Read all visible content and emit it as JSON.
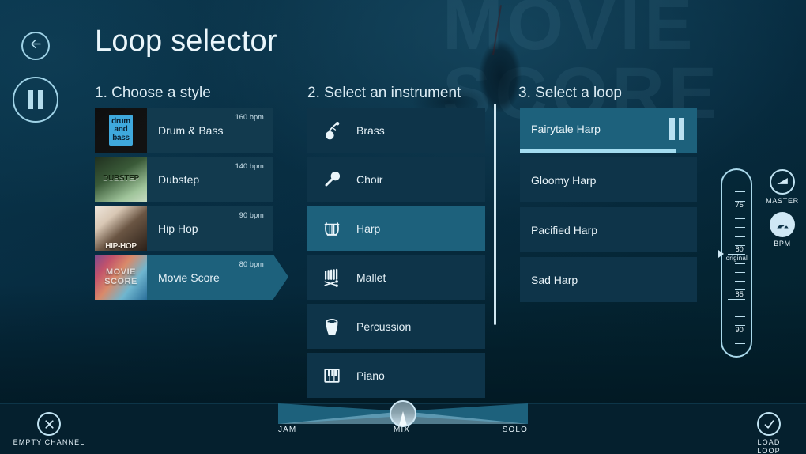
{
  "app": {
    "title": "Loop selector",
    "background_watermark": "MOVIE\nSCORE"
  },
  "header": {
    "back_icon": "back-arrow-icon",
    "transport_icon": "pause-icon"
  },
  "columns": {
    "style_heading": "1. Choose a style",
    "instrument_heading": "2. Select an instrument",
    "loop_heading": "3. Select a loop"
  },
  "styles": [
    {
      "name": "Drum & Bass",
      "bpm": "160 bpm",
      "thumb_text": "drum\nand\nbass",
      "selected": false
    },
    {
      "name": "Dubstep",
      "bpm": "140 bpm",
      "thumb_text": "DUBSTEP",
      "selected": false
    },
    {
      "name": "Hip Hop",
      "bpm": "90 bpm",
      "thumb_text": "HIP-HOP",
      "selected": false
    },
    {
      "name": "Movie Score",
      "bpm": "80 bpm",
      "thumb_text": "MOVIE\nSCORE",
      "selected": true
    }
  ],
  "instruments": [
    {
      "name": "Brass",
      "icon": "brass-horn-icon",
      "selected": false
    },
    {
      "name": "Choir",
      "icon": "microphone-icon",
      "selected": false
    },
    {
      "name": "Harp",
      "icon": "harp-lyre-icon",
      "selected": true
    },
    {
      "name": "Mallet",
      "icon": "xylophone-icon",
      "selected": false
    },
    {
      "name": "Percussion",
      "icon": "conga-drum-icon",
      "selected": false
    },
    {
      "name": "Piano",
      "icon": "piano-keys-icon",
      "selected": false
    }
  ],
  "loops": [
    {
      "name": "Fairytale Harp",
      "selected": true,
      "playing": true,
      "progress_percent": 88
    },
    {
      "name": "Gloomy Harp",
      "selected": false,
      "playing": false,
      "progress_percent": 0
    },
    {
      "name": "Pacified Harp",
      "selected": false,
      "playing": false,
      "progress_percent": 0
    },
    {
      "name": "Sad Harp",
      "selected": false,
      "playing": false,
      "progress_percent": 0
    }
  ],
  "bpm_slider": {
    "labels": [
      {
        "text": "75",
        "sub": ""
      },
      {
        "text": "80",
        "sub": "original"
      },
      {
        "text": "85",
        "sub": ""
      },
      {
        "text": "90",
        "sub": ""
      }
    ],
    "current_value": "80",
    "current_sub": "original"
  },
  "knobs": [
    {
      "label": "MASTER",
      "icon": "volume-wedge-icon",
      "style": "outline"
    },
    {
      "label": "BPM",
      "icon": "gauge-dial-icon",
      "style": "filled"
    }
  ],
  "bottom_bar": {
    "empty_channel_label": "EMPTY CHANNEL",
    "empty_channel_icon": "close-x-circle-icon",
    "load_loop_label": "LOAD\nLOOP",
    "load_loop_icon": "check-circle-icon",
    "mix_slider": {
      "left_label": "JAM",
      "center_label": "MIX",
      "right_label": "SOLO",
      "value_percent": 50
    }
  },
  "colors": {
    "accent": "#1d617c",
    "panel": "#0e3449",
    "panel_style": "#123a4e",
    "text": "#e6f2f8",
    "highlight": "#a3dcf0",
    "bottom_bar": "#05202e"
  }
}
